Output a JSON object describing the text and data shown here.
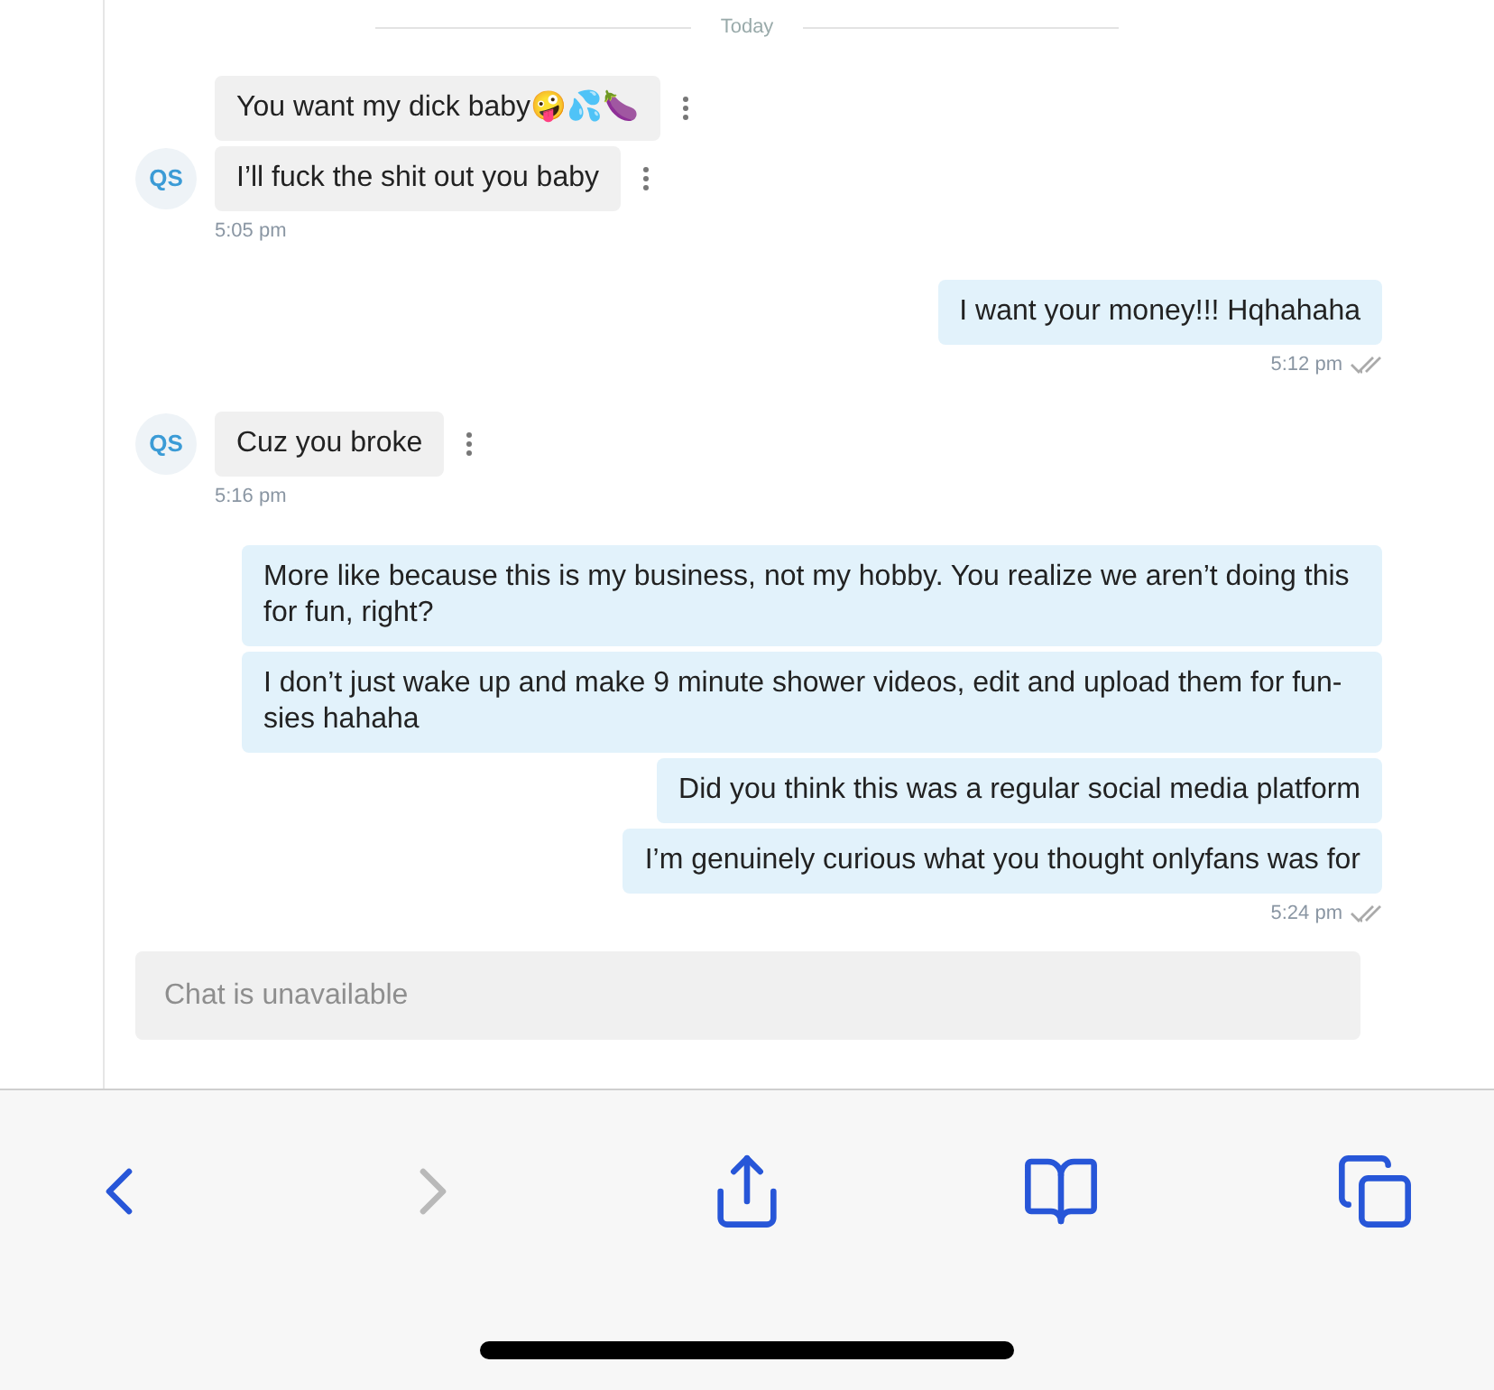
{
  "date_divider": "Today",
  "groups": [
    {
      "kind": "incoming",
      "avatar": "QS",
      "messages": [
        "You want my dick baby🤪💦🍆",
        "I’ll fuck the shit out you baby"
      ],
      "time": "5:05 pm"
    },
    {
      "kind": "outgoing",
      "messages": [
        "I want your money!!! Hqhahaha"
      ],
      "time": "5:12 pm"
    },
    {
      "kind": "incoming",
      "avatar": "QS",
      "messages": [
        "Cuz you broke"
      ],
      "time": "5:16 pm"
    },
    {
      "kind": "outgoing",
      "messages": [
        "More like because this is my business, not my hobby. You realize we aren’t doing this for fun, right?",
        "I don’t just wake up and make 9 minute shower videos, edit and upload them for fun-sies hahaha",
        "Did you think this was a regular social media platform",
        "I’m genuinely curious what you thought onlyfans was for"
      ],
      "time": "5:24 pm"
    }
  ],
  "input": {
    "placeholder": "Chat is unavailable"
  },
  "toolbar": [
    {
      "kind": "back",
      "disabled": false
    },
    {
      "kind": "forward",
      "disabled": true
    },
    {
      "kind": "share",
      "disabled": false
    },
    {
      "kind": "bookmarks",
      "disabled": false
    },
    {
      "kind": "tabs",
      "disabled": false
    }
  ]
}
